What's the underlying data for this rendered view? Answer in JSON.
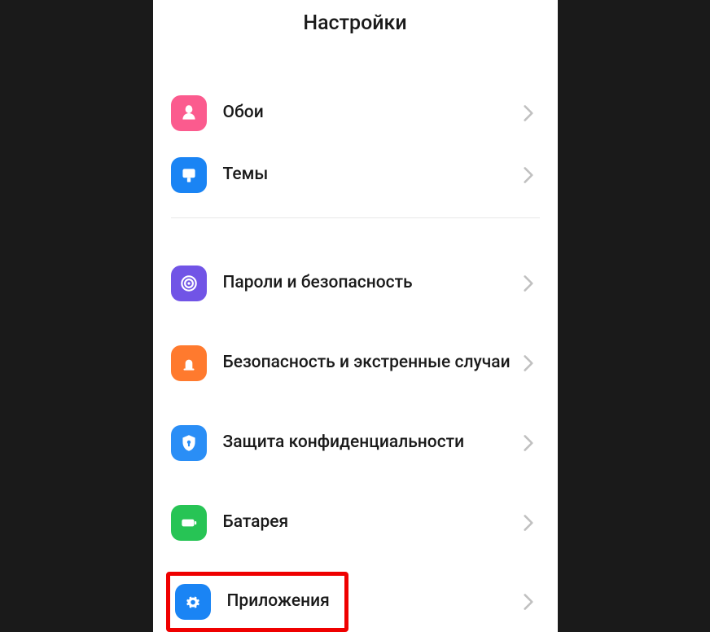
{
  "header": {
    "title": "Настройки"
  },
  "groups": [
    {
      "items": [
        {
          "id": "wallpaper",
          "label": "Обои",
          "icon": "flower-icon",
          "color": "#fb5b8e"
        },
        {
          "id": "themes",
          "label": "Темы",
          "icon": "brush-icon",
          "color": "#1a84f4"
        }
      ]
    },
    {
      "items": [
        {
          "id": "passwords",
          "label": "Пароли и безопасность",
          "icon": "fingerprint-icon",
          "color": "#7154e6"
        },
        {
          "id": "emergency",
          "label": "Безопасность и экстренные случаи",
          "icon": "alarm-icon",
          "color": "#ff7a2e"
        },
        {
          "id": "privacy",
          "label": "Защита конфиденциальности",
          "icon": "shield-icon",
          "color": "#2a8ef6"
        },
        {
          "id": "battery",
          "label": "Батарея",
          "icon": "battery-icon",
          "color": "#27c455"
        },
        {
          "id": "apps",
          "label": "Приложения",
          "icon": "gear-icon",
          "color": "#1a84f4",
          "highlighted": true
        }
      ]
    }
  ]
}
